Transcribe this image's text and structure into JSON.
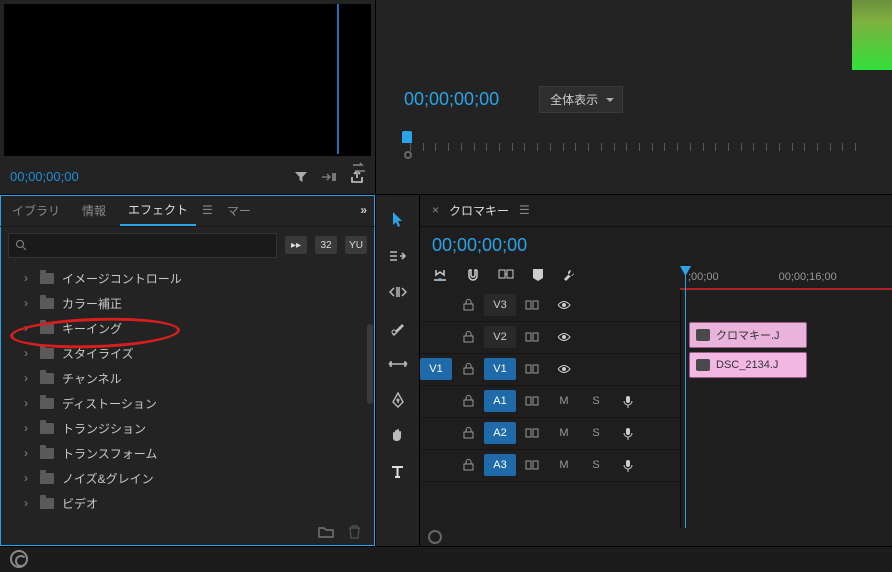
{
  "previewLeft": {
    "timecode": "00;00;00;00"
  },
  "previewRight": {
    "timecode": "00;00;00;00",
    "viewMode": "全体表示"
  },
  "panelTabs": {
    "library": "イブラリ",
    "info": "情報",
    "effects": "エフェクト",
    "marker": "マー"
  },
  "search": {
    "placeholder": ""
  },
  "presetButtons": {
    "b1": "▸▸",
    "b2": "32",
    "b3": "YU"
  },
  "fxList": [
    "イメージコントロール",
    "カラー補正",
    "キーイング",
    "スタイライズ",
    "チャンネル",
    "ディストーション",
    "トランジション",
    "トランスフォーム",
    "ノイズ&グレイン",
    "ビデオ"
  ],
  "timeline": {
    "title": "クロマキー",
    "timecode": "00;00;00;00",
    "ruler": {
      "t1": ";00;00",
      "t2": "00;00;16;00"
    },
    "tracks": {
      "v3": "V3",
      "v2": "V2",
      "v1": "V1",
      "v1src": "V1",
      "a1": "A1",
      "a2": "A2",
      "a3": "A3"
    },
    "buttons": {
      "m": "M",
      "s": "S"
    },
    "clips": {
      "a": "クロマキー.J",
      "b": "DSC_2134.J"
    }
  }
}
